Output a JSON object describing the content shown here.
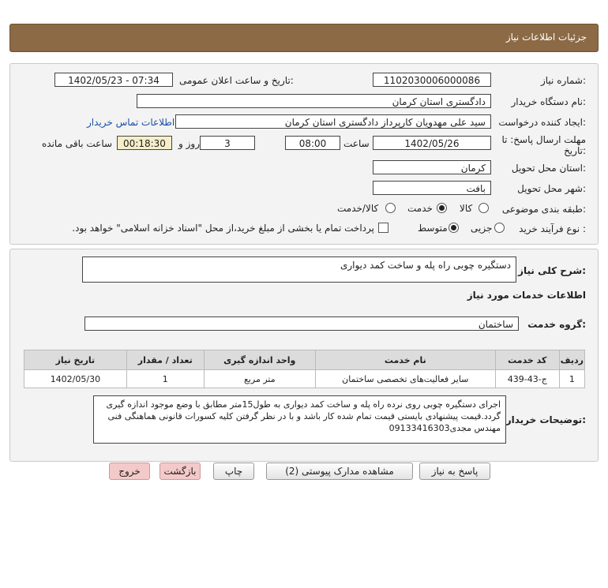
{
  "header": {
    "title": "جزئیات اطلاعات نیاز"
  },
  "form": {
    "need_number_label": "شماره نیاز:",
    "need_number": "1102030006000086",
    "announce_label": "تاریخ و ساعت اعلان عمومی:",
    "announce_value": "1402/05/23 - 07:34",
    "buyer_org_label": "نام دستگاه خریدار:",
    "buyer_org": "دادگستری استان کرمان",
    "creator_label": "ایجاد کننده درخواست:",
    "creator": "سید علی مهدویان کارپرداز دادگستری استان کرمان",
    "contact_link": "اطلاعات تماس خریدار",
    "deadline_label_1": "مهلت ارسال پاسخ: تا",
    "deadline_label_2": "تاریخ:",
    "deadline_date": "1402/05/26",
    "time_label": "ساعت",
    "deadline_time": "08:00",
    "days_count": "3",
    "days_label": "روز و",
    "remaining_time": "00:18:30",
    "remaining_label": "ساعت باقی مانده",
    "province_label": "استان محل تحویل:",
    "province": "کرمان",
    "city_label": "شهر محل تحویل:",
    "city": "بافت",
    "category_label": "طبقه بندی موضوعی:",
    "category_options": [
      "کالا",
      "خدمت",
      "کالا/خدمت"
    ],
    "category_selected": "خدمت",
    "process_label": "نوع فرآیند خرید :",
    "process_options": [
      "جزیی",
      "متوسط"
    ],
    "process_selected": "متوسط",
    "payment_note": "پرداخت تمام یا بخشی از مبلغ خرید،از محل \"اسناد خزانه اسلامی\" خواهد بود."
  },
  "description": {
    "label": "شرح کلی نیاز:",
    "value": "دستگیره چوبی راه پله و ساخت کمد دیواری"
  },
  "services": {
    "section_title": "اطلاعات خدمات مورد نیاز",
    "group_label": "گروه خدمت:",
    "group_value": "ساختمان",
    "table": {
      "headers": [
        "ردیف",
        "کد خدمت",
        "نام خدمت",
        "واحد اندازه گیری",
        "تعداد / مقدار",
        "تاریخ نیاز"
      ],
      "rows": [
        [
          "1",
          "ج-43-439",
          "سایر فعالیت‌های تخصصی ساختمان",
          "متر مربع",
          "1",
          "1402/05/30"
        ]
      ]
    }
  },
  "buyer_notes": {
    "label": "توضیحات خریدار:",
    "text": "اجرای دستگیره چوبی روی نرده راه پله و ساخت کمد دیواری به طول15متر مطابق با وضع موجود اندازه گیری گردد.قیمت پیشنهادی بایستی قیمت تمام شده کار باشد و با در نظر گرفتن کلیه کسورات قانونی هماهنگی فنی مهندس مجدی09133416303"
  },
  "buttons": {
    "reply": "پاسخ به نیاز",
    "attachments": "مشاهده مدارک پیوستی (2)",
    "print": "چاپ",
    "back": "بازگشت",
    "exit": "خروج"
  }
}
